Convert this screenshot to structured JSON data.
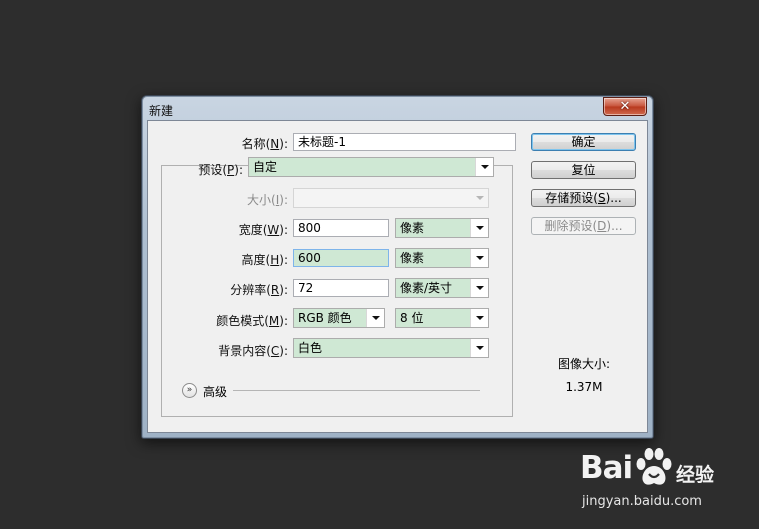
{
  "dialog": {
    "title": "新建",
    "close_icon": "close-icon",
    "name": {
      "label_pre": "名称(",
      "hotkey": "N",
      "label_post": "):",
      "value": "未标题-1"
    },
    "preset": {
      "label_pre": "预设(",
      "hotkey": "P",
      "label_post": "):",
      "value": "自定"
    },
    "size": {
      "label_pre": "大小(",
      "hotkey": "I",
      "label_post": "):",
      "value": ""
    },
    "width": {
      "label_pre": "宽度(",
      "hotkey": "W",
      "label_post": "):",
      "value": "800",
      "unit": "像素"
    },
    "height": {
      "label_pre": "高度(",
      "hotkey": "H",
      "label_post": "):",
      "value": "600",
      "unit": "像素"
    },
    "resolution": {
      "label_pre": "分辨率(",
      "hotkey": "R",
      "label_post": "):",
      "value": "72",
      "unit": "像素/英寸"
    },
    "color_mode": {
      "label_pre": "颜色模式(",
      "hotkey": "M",
      "label_post": "):",
      "mode": "RGB 颜色",
      "depth": "8 位"
    },
    "background": {
      "label_pre": "背景内容(",
      "hotkey": "C",
      "label_post": "):",
      "value": "白色"
    },
    "advanced": {
      "label": "高级",
      "icon": "expand-chevrons-icon"
    },
    "buttons": {
      "ok": "确定",
      "reset": "复位",
      "save_preset": {
        "pre": "存储预设(",
        "hotkey": "S",
        "post": ")..."
      },
      "delete_preset": {
        "pre": "删除预设(",
        "hotkey": "D",
        "post": ")..."
      }
    },
    "image_size": {
      "label": "图像大小:",
      "value": "1.37M"
    }
  },
  "watermark": {
    "brand": "Bai",
    "brand_suffix": "经验",
    "url": "jingyan.baidu.com"
  },
  "colors": {
    "field_highlight": "#cfe8d4",
    "title_bar": "#b7c7d8",
    "close_button": "#c8553c",
    "backdrop": "#2d2d2d"
  }
}
